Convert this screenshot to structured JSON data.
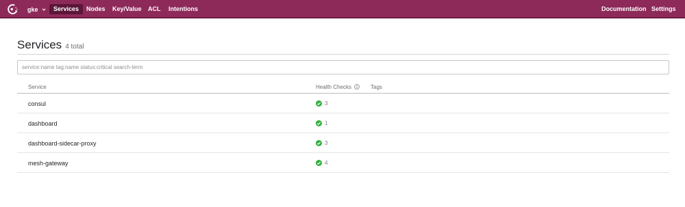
{
  "app": {
    "colors": {
      "topbar": "#8e2a5a",
      "active_nav": "#5b1638",
      "passing": "#2eb039"
    },
    "logo_icon": "consul-logo-icon"
  },
  "header": {
    "datacenter": "gke",
    "nav": [
      {
        "label": "Services",
        "active": true
      },
      {
        "label": "Nodes",
        "active": false
      },
      {
        "label": "Key/Value",
        "active": false
      },
      {
        "label": "ACL",
        "active": false
      },
      {
        "label": "Intentions",
        "active": false
      }
    ],
    "right": [
      {
        "label": "Documentation"
      },
      {
        "label": "Settings"
      }
    ]
  },
  "page": {
    "title": "Services",
    "count": "4 total"
  },
  "search": {
    "placeholder": "service:name tag:name status:critical search-term",
    "value": ""
  },
  "table": {
    "columns": {
      "service": "Service",
      "health": "Health Checks",
      "tags": "Tags"
    },
    "rows": [
      {
        "name": "consul",
        "checks": "3",
        "status": "passing"
      },
      {
        "name": "dashboard",
        "checks": "1",
        "status": "passing"
      },
      {
        "name": "dashboard-sidecar-proxy",
        "checks": "3",
        "status": "passing"
      },
      {
        "name": "mesh-gateway",
        "checks": "4",
        "status": "passing"
      }
    ]
  }
}
